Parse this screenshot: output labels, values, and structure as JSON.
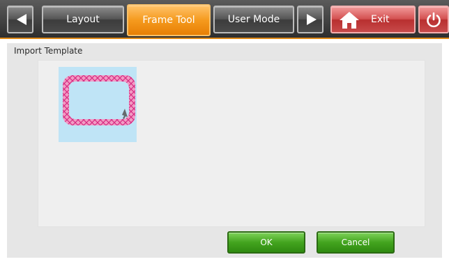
{
  "toolbar": {
    "back_icon": "left-arrow-icon",
    "tabs": [
      {
        "label": "Layout",
        "active": false
      },
      {
        "label": "Frame Tool",
        "active": true
      },
      {
        "label": "User Mode",
        "active": false
      }
    ],
    "forward_icon": "right-arrow-icon",
    "exit_label": "Exit",
    "home_icon": "home-icon",
    "power_icon": "power-icon",
    "accent_color": "#f59a1e",
    "exit_color": "#d35050"
  },
  "panel": {
    "title": "Import Template",
    "template_thumbnail": {
      "icon": "rounded-rect-frame-icon",
      "fill_color": "#bfe4f6",
      "border_color": "#e8479a"
    }
  },
  "buttons": {
    "ok_label": "OK",
    "cancel_label": "Cancel",
    "color": "#43a41f"
  }
}
